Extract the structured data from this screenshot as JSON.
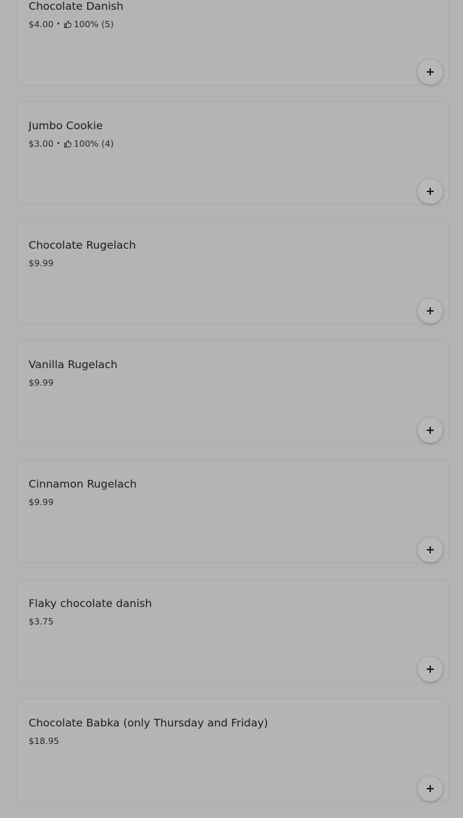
{
  "items": [
    {
      "name": "Chocolate Danish",
      "price": "$4.00",
      "sep": "•",
      "rating": "100% (5)",
      "has_rating": true
    },
    {
      "name": "Jumbo Cookie",
      "price": "$3.00",
      "sep": "•",
      "rating": "100% (4)",
      "has_rating": true
    },
    {
      "name": "Chocolate Rugelach",
      "price": "$9.99",
      "has_rating": false
    },
    {
      "name": "Vanilla Rugelach",
      "price": "$9.99",
      "has_rating": false
    },
    {
      "name": "Cinnamon Rugelach",
      "price": "$9.99",
      "has_rating": false
    },
    {
      "name": "Flaky chocolate danish",
      "price": "$3.75",
      "has_rating": false
    },
    {
      "name": "Chocolate Babka (only Thursday and Friday)",
      "price": "$18.95",
      "has_rating": false
    }
  ],
  "icons": {
    "rating": "thumbs-up-icon",
    "add": "plus-icon"
  }
}
